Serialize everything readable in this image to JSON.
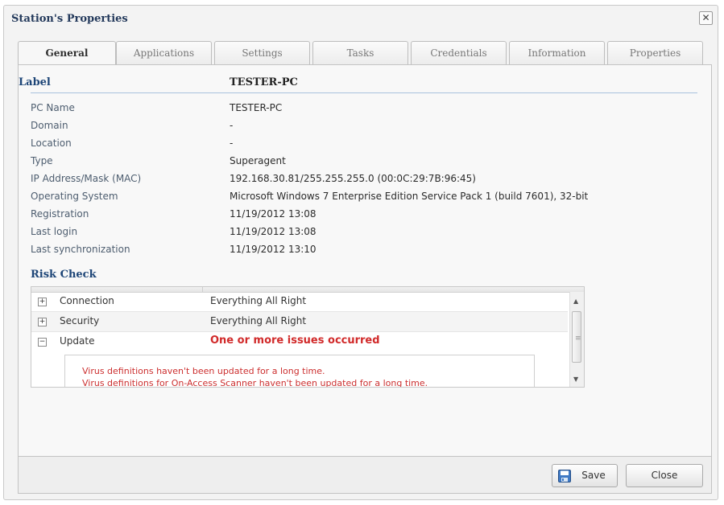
{
  "window": {
    "title": "Station's Properties",
    "close_glyph": "✕"
  },
  "tabs": [
    {
      "label": "General",
      "active": true
    },
    {
      "label": "Applications"
    },
    {
      "label": "Settings"
    },
    {
      "label": "Tasks"
    },
    {
      "label": "Credentials"
    },
    {
      "label": "Information"
    },
    {
      "label": "Properties"
    }
  ],
  "general": {
    "label_key": "Label",
    "label_value": "TESTER-PC",
    "properties": [
      {
        "key": "PC Name",
        "value": "TESTER-PC"
      },
      {
        "key": "Domain",
        "value": "-"
      },
      {
        "key": "Location",
        "value": "-"
      },
      {
        "key": "Type",
        "value": "Superagent"
      },
      {
        "key": "IP Address/Mask (MAC)",
        "value": "192.168.30.81/255.255.255.0 (00:0C:29:7B:96:45)"
      },
      {
        "key": "Operating System",
        "value": "Microsoft Windows 7 Enterprise Edition Service Pack 1 (build 7601), 32-bit"
      },
      {
        "key": "Registration",
        "value": "11/19/2012 13:08"
      },
      {
        "key": "Last login",
        "value": "11/19/2012 13:08"
      },
      {
        "key": "Last synchronization",
        "value": "11/19/2012 13:10"
      }
    ],
    "risk_check": {
      "title": "Risk Check",
      "rows": [
        {
          "name": "Connection",
          "status": "Everything All Right",
          "expander": "+"
        },
        {
          "name": "Security",
          "status": "Everything All Right",
          "expander": "+"
        },
        {
          "name": "Update",
          "status": "One or more issues occurred",
          "expander": "−",
          "expanded": true
        }
      ],
      "details": [
        "Virus definitions haven't been updated for a long time.",
        "Virus definitions for On-Access Scanner haven't been updated for a long time."
      ]
    }
  },
  "buttons": {
    "save": "Save",
    "close": "Close"
  },
  "colors": {
    "accent": "#1d4577",
    "error": "#d12a2a"
  }
}
